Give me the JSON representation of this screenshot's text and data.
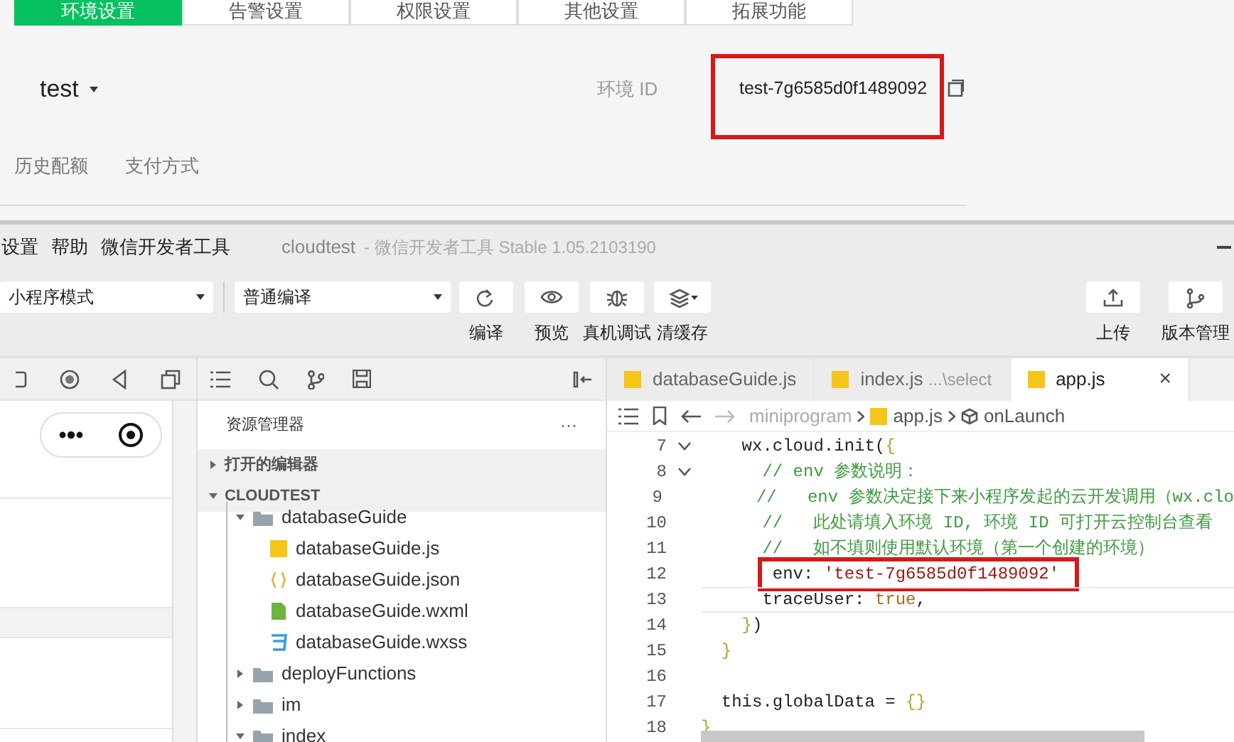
{
  "console": {
    "tabs": [
      {
        "label": "环境设置",
        "selected": true
      },
      {
        "label": "告警设置",
        "selected": false
      },
      {
        "label": "权限设置",
        "selected": false
      },
      {
        "label": "其他设置",
        "selected": false
      },
      {
        "label": "拓展功能",
        "selected": false
      }
    ],
    "env_name": "test",
    "env_id_label": "环境 ID",
    "env_id": "test-7g6585d0f1489092",
    "env_id_annotated": true,
    "subtabs": [
      "历史配额",
      "支付方式"
    ]
  },
  "devtool": {
    "menu": [
      "设置",
      "帮助",
      "微信开发者工具"
    ],
    "title": "cloudtest",
    "subtitle": "- 微信开发者工具 Stable 1.05.2103190",
    "mode_select": "小程序模式",
    "compile_select": "普通编译",
    "tools": [
      {
        "kind": "refresh",
        "label": "编译"
      },
      {
        "kind": "eye",
        "label": "预览"
      },
      {
        "kind": "bug",
        "label": "真机调试"
      },
      {
        "kind": "layers",
        "label": "清缓存"
      }
    ],
    "right_tools": [
      {
        "kind": "upload",
        "label": "上传"
      },
      {
        "kind": "branch",
        "label": "版本管理"
      }
    ],
    "explorer": {
      "title": "资源管理器",
      "more": "···",
      "sections": [
        {
          "label": "打开的编辑器",
          "expanded": false
        },
        {
          "label": "CLOUDTEST",
          "expanded": true
        }
      ],
      "tree": [
        {
          "label": "databaseGuide",
          "kind": "folder",
          "expanded": true,
          "children": [
            {
              "label": "databaseGuide.js",
              "kind": "js"
            },
            {
              "label": "databaseGuide.json",
              "kind": "json"
            },
            {
              "label": "databaseGuide.wxml",
              "kind": "wxml"
            },
            {
              "label": "databaseGuide.wxss",
              "kind": "wxss"
            }
          ]
        },
        {
          "label": "deployFunctions",
          "kind": "folder",
          "expanded": false
        },
        {
          "label": "im",
          "kind": "folder",
          "expanded": false
        },
        {
          "label": "index",
          "kind": "folder",
          "expanded": true
        }
      ]
    },
    "editor": {
      "tabs": [
        {
          "label": "databaseGuide.js",
          "selected": false
        },
        {
          "label": "index.js",
          "hint": "...\\select",
          "selected": false
        },
        {
          "label": "app.js",
          "selected": true,
          "close": "×"
        }
      ],
      "breadcrumb": [
        "miniprogram",
        "app.js",
        "onLaunch"
      ],
      "lines": [
        {
          "number": "7",
          "fold": true,
          "tokens": [
            {
              "kind": "plain",
              "text": "    wx.cloud.init("
            },
            {
              "kind": "bracket",
              "text": "{"
            }
          ]
        },
        {
          "number": "8",
          "fold": true,
          "tokens": [
            {
              "kind": "comment",
              "text": "      // env 参数说明："
            }
          ]
        },
        {
          "number": "9",
          "fold": false,
          "tokens": [
            {
              "kind": "comment",
              "text": "      //   env 参数决定接下来小程序发起的云开发调用（wx.clo"
            }
          ]
        },
        {
          "number": "10",
          "fold": false,
          "tokens": [
            {
              "kind": "comment",
              "text": "      //   此处请填入环境 ID, 环境 ID 可打开云控制台查看"
            }
          ]
        },
        {
          "number": "11",
          "fold": false,
          "tokens": [
            {
              "kind": "comment",
              "text": "      //   如不填则使用默认环境（第一个创建的环境）"
            }
          ]
        },
        {
          "number": "12",
          "fold": false,
          "annotated": true,
          "tokens": [
            {
              "kind": "plain",
              "text": "       env: "
            },
            {
              "kind": "string",
              "text": "'test-7g6585d0f1489092'"
            }
          ]
        },
        {
          "number": "13",
          "fold": false,
          "current": true,
          "tokens": [
            {
              "kind": "plain",
              "text": "      traceUser: "
            },
            {
              "kind": "keyword",
              "text": "true"
            },
            {
              "kind": "plain",
              "text": ","
            }
          ]
        },
        {
          "number": "14",
          "fold": false,
          "tokens": [
            {
              "kind": "bracket",
              "text": "    }"
            },
            {
              "kind": "plain",
              "text": ")"
            }
          ]
        },
        {
          "number": "15",
          "fold": false,
          "tokens": [
            {
              "kind": "bracket",
              "text": "  }"
            }
          ]
        },
        {
          "number": "16",
          "fold": false
        },
        {
          "number": "17",
          "fold": false,
          "tokens": [
            {
              "kind": "plain",
              "text": "  this.globalData = "
            },
            {
              "kind": "bracket",
              "text": "{}"
            }
          ]
        },
        {
          "number": "18",
          "fold": false,
          "tokens": [
            {
              "kind": "bracket",
              "text": "}"
            }
          ]
        }
      ]
    }
  }
}
